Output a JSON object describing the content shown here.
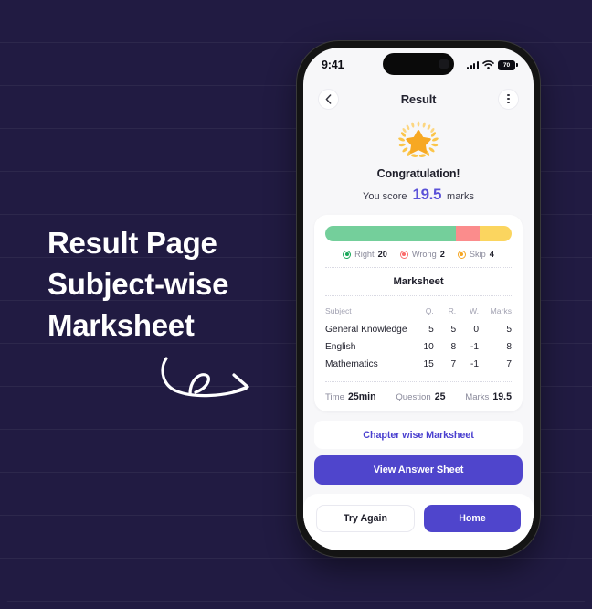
{
  "poster": {
    "caption_lines": [
      "Result Page",
      "Subject-wise",
      "Marksheet"
    ],
    "background_color": "#211b42",
    "accent_color": "#4f45cc"
  },
  "phone": {
    "status_bar": {
      "time": "9:41",
      "battery_level": "70",
      "cellular_icon": "signal-bars-icon",
      "wifi_icon": "wifi-icon",
      "battery_icon": "battery-icon"
    },
    "nav": {
      "back_icon": "chevron-left-icon",
      "title": "Result",
      "more_icon": "more-vertical-icon"
    },
    "hero": {
      "award_icon": "star-laurel-award-icon",
      "congrats": "Congratulation!",
      "score_prefix": "You score",
      "score_value": "19.5",
      "score_suffix": "marks"
    },
    "progress": {
      "segments": [
        {
          "key": "right",
          "percent": 70,
          "color": "#74cf9b"
        },
        {
          "key": "wrong",
          "percent": 13,
          "color": "#fb8c8c"
        },
        {
          "key": "skip",
          "percent": 17,
          "color": "#fbd55f"
        }
      ],
      "legend": [
        {
          "label": "Right",
          "value": "20",
          "color": "#1aa85a"
        },
        {
          "label": "Wrong",
          "value": "2",
          "color": "#fa6b6b"
        },
        {
          "label": "Skip",
          "value": "4",
          "color": "#f5a623"
        }
      ]
    },
    "marksheet": {
      "title": "Marksheet",
      "columns": [
        "Subject",
        "Q.",
        "R.",
        "W.",
        "Marks"
      ],
      "rows": [
        {
          "subject": "General Knowledge",
          "q": "5",
          "r": "5",
          "w": "0",
          "marks": "5"
        },
        {
          "subject": "English",
          "q": "10",
          "r": "8",
          "w": "-1",
          "marks": "8"
        },
        {
          "subject": "Mathematics",
          "q": "15",
          "r": "7",
          "w": "-1",
          "marks": "7"
        }
      ],
      "summary": {
        "time_label": "Time",
        "time_value": "25min",
        "question_label": "Question",
        "question_value": "25",
        "marks_label": "Marks",
        "marks_value": "19.5"
      }
    },
    "actions": {
      "chapter_wise": "Chapter wise Marksheet",
      "view_answer": "View Answer Sheet"
    },
    "bottom_bar": {
      "try_again": "Try Again",
      "home": "Home"
    }
  }
}
